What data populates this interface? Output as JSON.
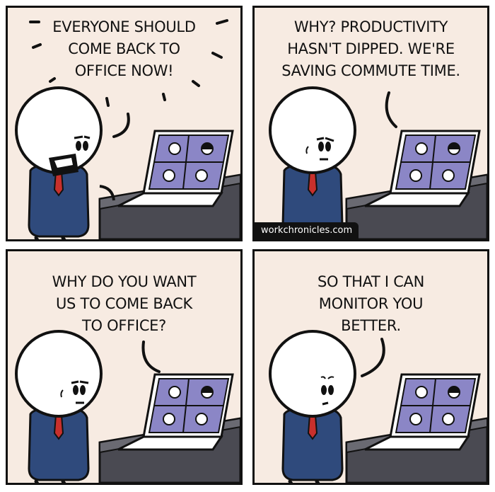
{
  "panels": [
    {
      "speech": "EVERYONE SHOULD\nCOME BACK TO\nOFFICE NOW!"
    },
    {
      "speech": "WHY? PRODUCTIVITY\nHASN'T DIPPED. WE'RE\nSAVING COMMUTE TIME."
    },
    {
      "speech": "WHY DO YOU WANT\nUS TO COME BACK\nTO OFFICE?"
    },
    {
      "speech": "SO THAT I CAN\nMONITOR YOU\nBETTER."
    }
  ],
  "watermark": "workchronicles.com",
  "colors": {
    "panel_bg": "#f7ebe2",
    "suit": "#2f4a7c",
    "tie": "#c8302c",
    "desk": "#4a4a52",
    "screen": "#8b86c6"
  }
}
